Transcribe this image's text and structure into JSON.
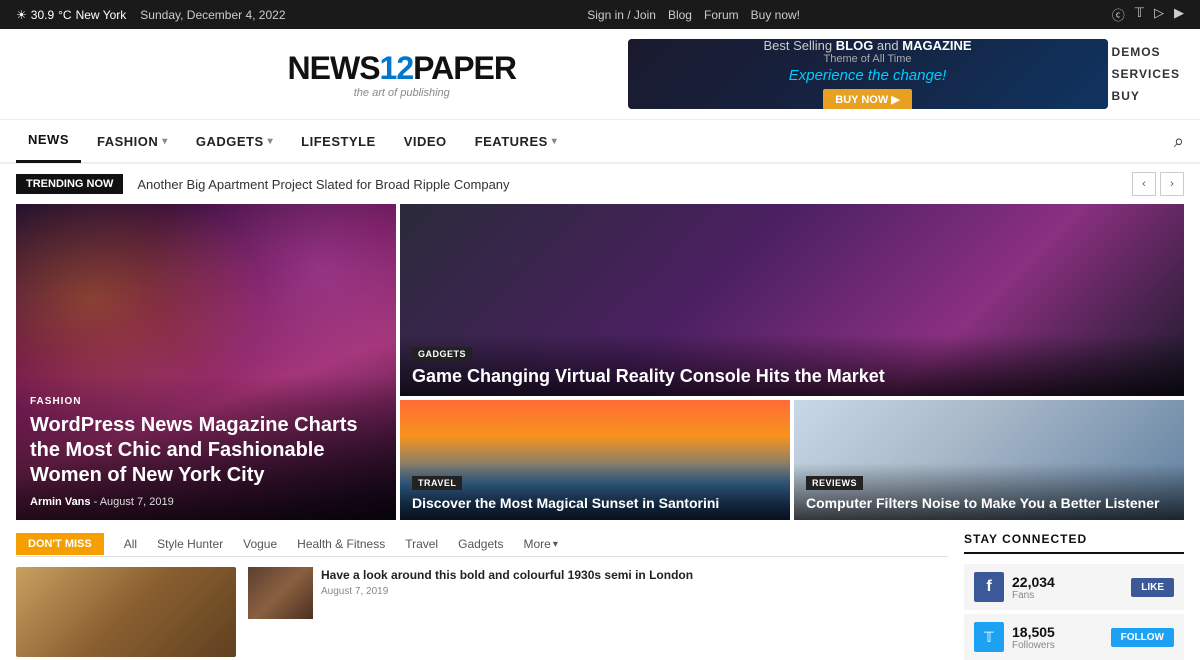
{
  "topbar": {
    "weather_icon": "☀",
    "temperature": "30.9",
    "unit": "°C",
    "location": "New York",
    "date": "Sunday, December 4, 2022",
    "links": [
      "Sign in / Join",
      "Blog",
      "Forum",
      "Buy now!"
    ],
    "social_icons": [
      "f",
      "ig",
      "tw",
      "vi",
      "yt"
    ]
  },
  "header": {
    "logo_text_1": "NEWS",
    "logo_num": "12",
    "logo_text_2": "PAPER",
    "tagline": "the art of publishing",
    "ad_line1_pre": "Best Selling ",
    "ad_line1_bold1": "BLOG",
    "ad_line1_mid": " and ",
    "ad_line1_bold2": "MAGAZINE",
    "ad_line2": "Theme of All Time",
    "ad_line3": "Experience the change!",
    "ad_btn": "BUY NOW ▶",
    "side_menu": [
      "DEMOS",
      "SERVICES",
      "BUY"
    ]
  },
  "nav": {
    "items": [
      {
        "label": "NEWS",
        "active": true,
        "has_arrow": false
      },
      {
        "label": "FASHION",
        "active": false,
        "has_arrow": true
      },
      {
        "label": "GADGETS",
        "active": false,
        "has_arrow": true
      },
      {
        "label": "LIFESTYLE",
        "active": false,
        "has_arrow": false
      },
      {
        "label": "VIDEO",
        "active": false,
        "has_arrow": false
      },
      {
        "label": "FEATURES",
        "active": false,
        "has_arrow": true
      }
    ]
  },
  "trending": {
    "badge": "TRENDING NOW",
    "text": "Another Big Apartment Project Slated for Broad Ripple Company"
  },
  "feature_article": {
    "category": "FASHION",
    "title": "WordPress News Magazine Charts the Most Chic and Fashionable Women of New York City",
    "author": "Armin Vans",
    "date": "August 7, 2019"
  },
  "side_articles": {
    "top": {
      "category": "GADGETS",
      "title": "Game Changing Virtual Reality Console Hits the Market"
    },
    "bottom_left": {
      "category": "TRAVEL",
      "title": "Discover the Most Magical Sunset in Santorini"
    },
    "bottom_right": {
      "category": "REVIEWS",
      "title": "Computer Filters Noise to Make You a Better Listener"
    }
  },
  "dont_miss": {
    "badge": "DON'T MISS",
    "tabs": [
      "All",
      "Style Hunter",
      "Vogue",
      "Health & Fitness",
      "Travel",
      "Gadgets",
      "More"
    ],
    "articles": [
      {
        "title": "Have a look around this bold and colourful 1930s semi in London",
        "date": "August 7, 2019",
        "has_image": true
      }
    ]
  },
  "stay_connected": {
    "header": "STAY CONNECTED",
    "facebook": {
      "count": "22,034",
      "label": "Fans",
      "btn": "LIKE"
    },
    "twitter": {
      "count": "18,505",
      "label": "Followers",
      "btn": "FOLLOW"
    }
  }
}
